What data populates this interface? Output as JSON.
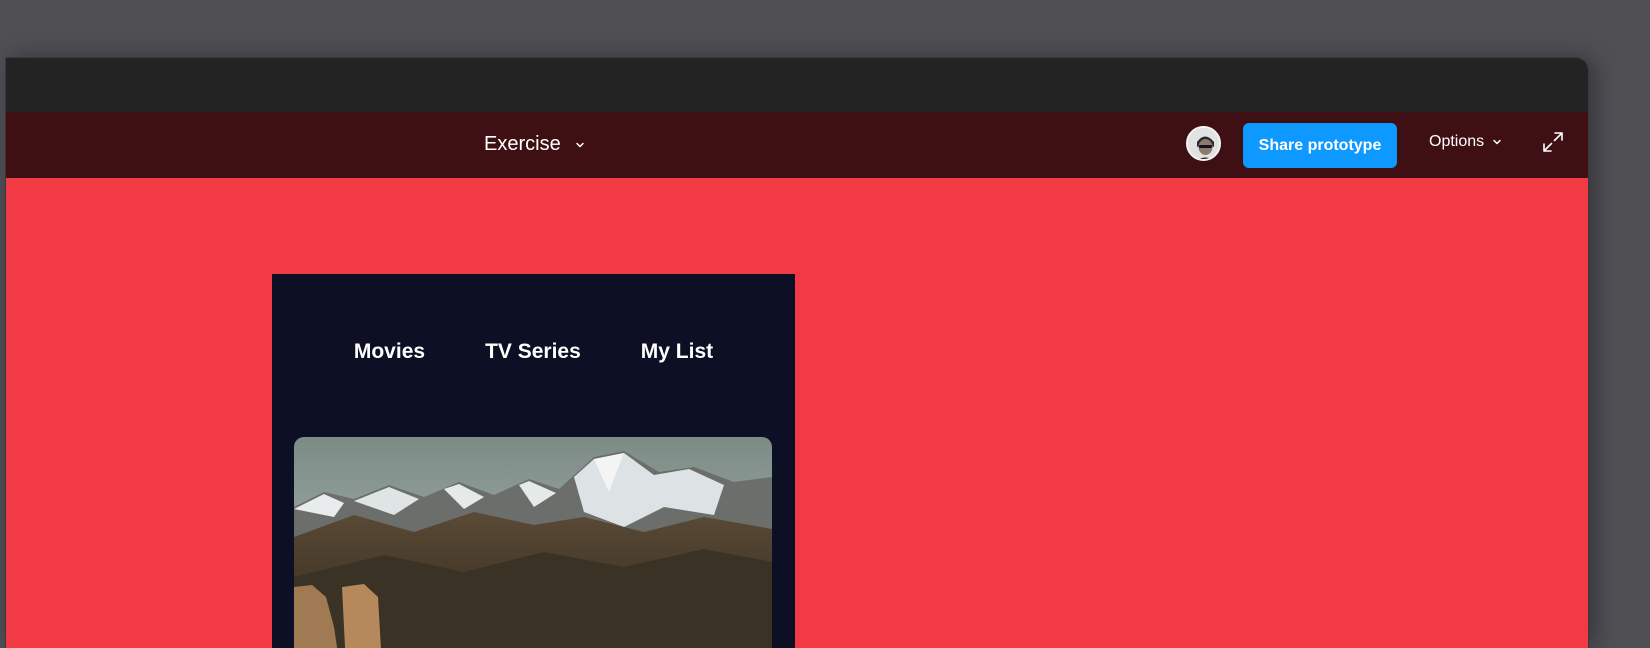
{
  "prototype": {
    "title": "Exercise",
    "title_chevron_icon": "chevron-down-icon"
  },
  "toolbar": {
    "avatar_icon": "user-avatar",
    "share_label": "Share prototype",
    "share_color": "#0d99ff",
    "options_label": "Options",
    "options_chevron_icon": "chevron-down-icon",
    "expand_icon": "expand-icon"
  },
  "app": {
    "background_color": "#f23a44",
    "frame_color": "#0d0f24",
    "nav": [
      "Movies",
      "TV Series",
      "My List"
    ],
    "hero_image": "mountain-landscape-image"
  }
}
